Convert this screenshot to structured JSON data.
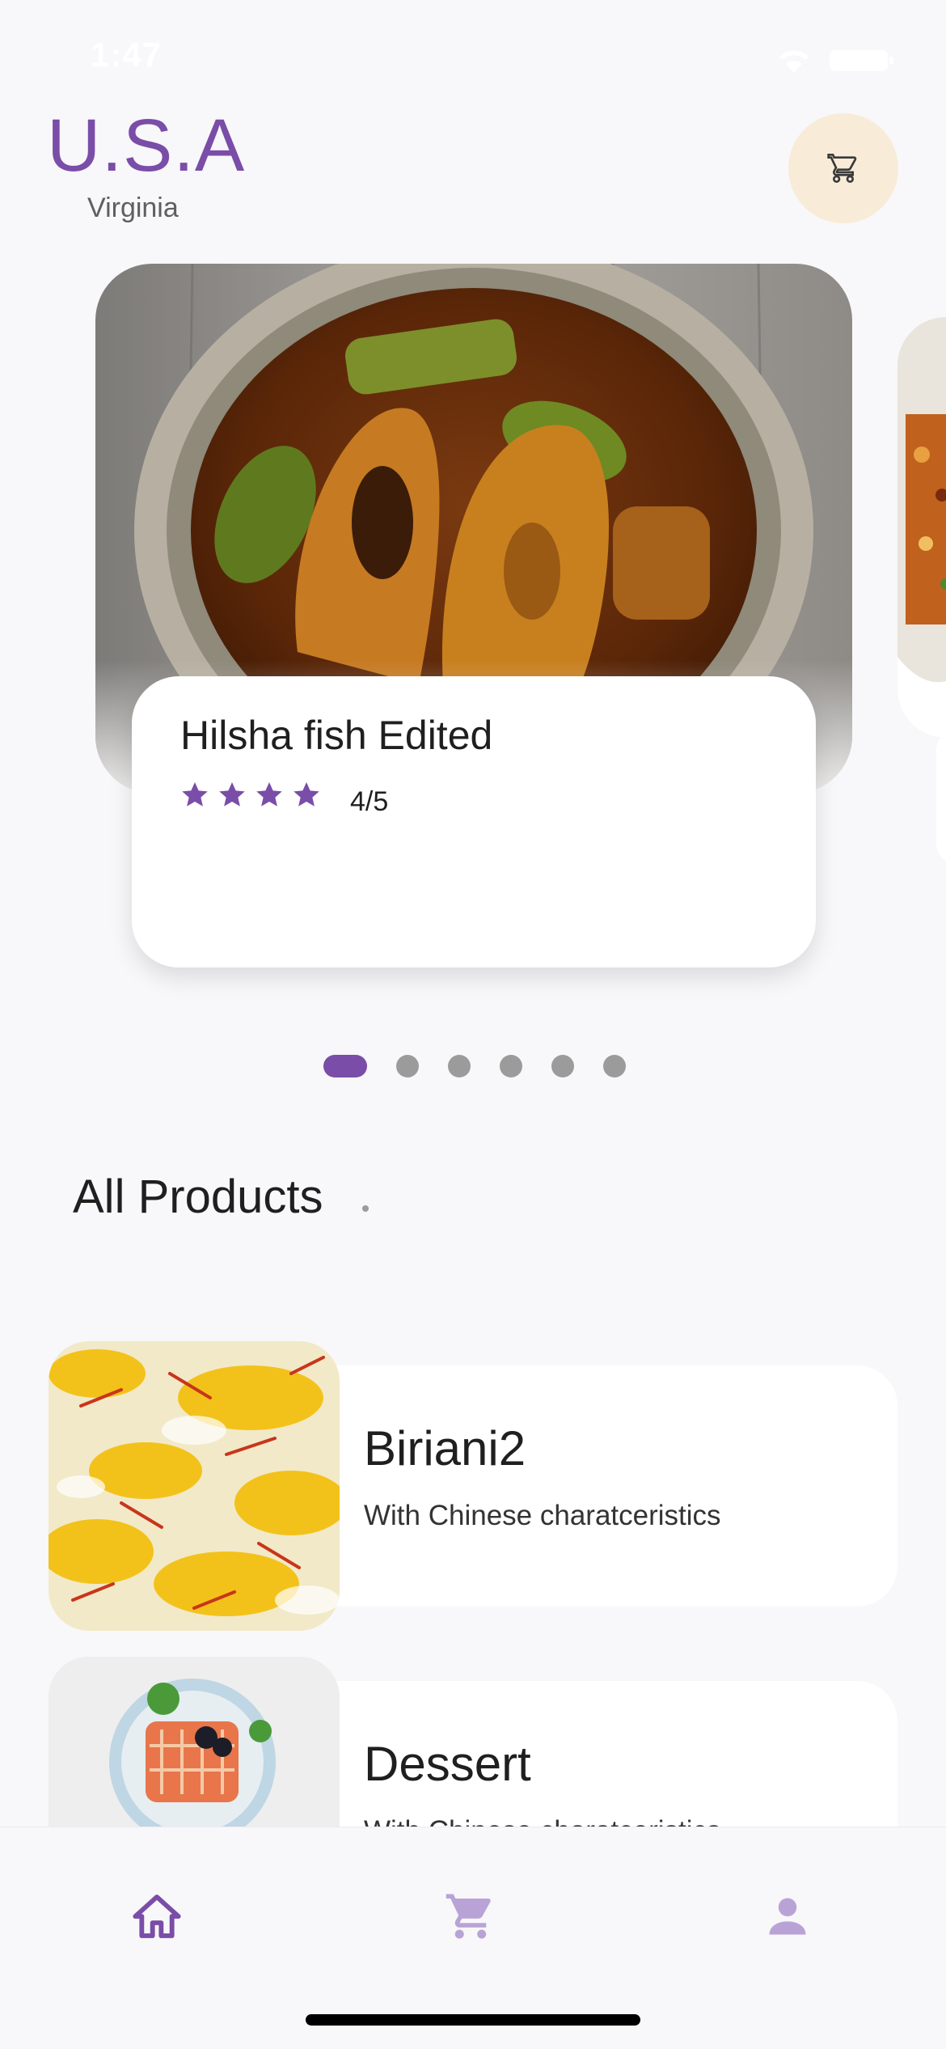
{
  "status_bar": {
    "time": "1:47"
  },
  "header": {
    "country": "U.S.A",
    "state": "Virginia",
    "cart_icon": "cart-icon"
  },
  "carousel": {
    "featured": {
      "name": "Hilsha fish Edited",
      "rating_text": "4/5",
      "rating_value": 4,
      "rating_max": 5
    },
    "page_count": 6,
    "active_index": 0
  },
  "section": {
    "title": "All Products"
  },
  "products": [
    {
      "name": "Biriani2",
      "description": "With Chinese charatceristics"
    },
    {
      "name": "Dessert",
      "description": "With Chinese charatceristics"
    }
  ],
  "bottom_nav": [
    {
      "icon": "home-icon",
      "active": true
    },
    {
      "icon": "cart-icon",
      "active": false
    },
    {
      "icon": "person-icon",
      "active": false
    }
  ],
  "colors": {
    "accent": "#7a4da8",
    "accent_light": "#b9a3d6",
    "cart_bg": "#f8ecd8",
    "background": "#f8f7f9"
  }
}
